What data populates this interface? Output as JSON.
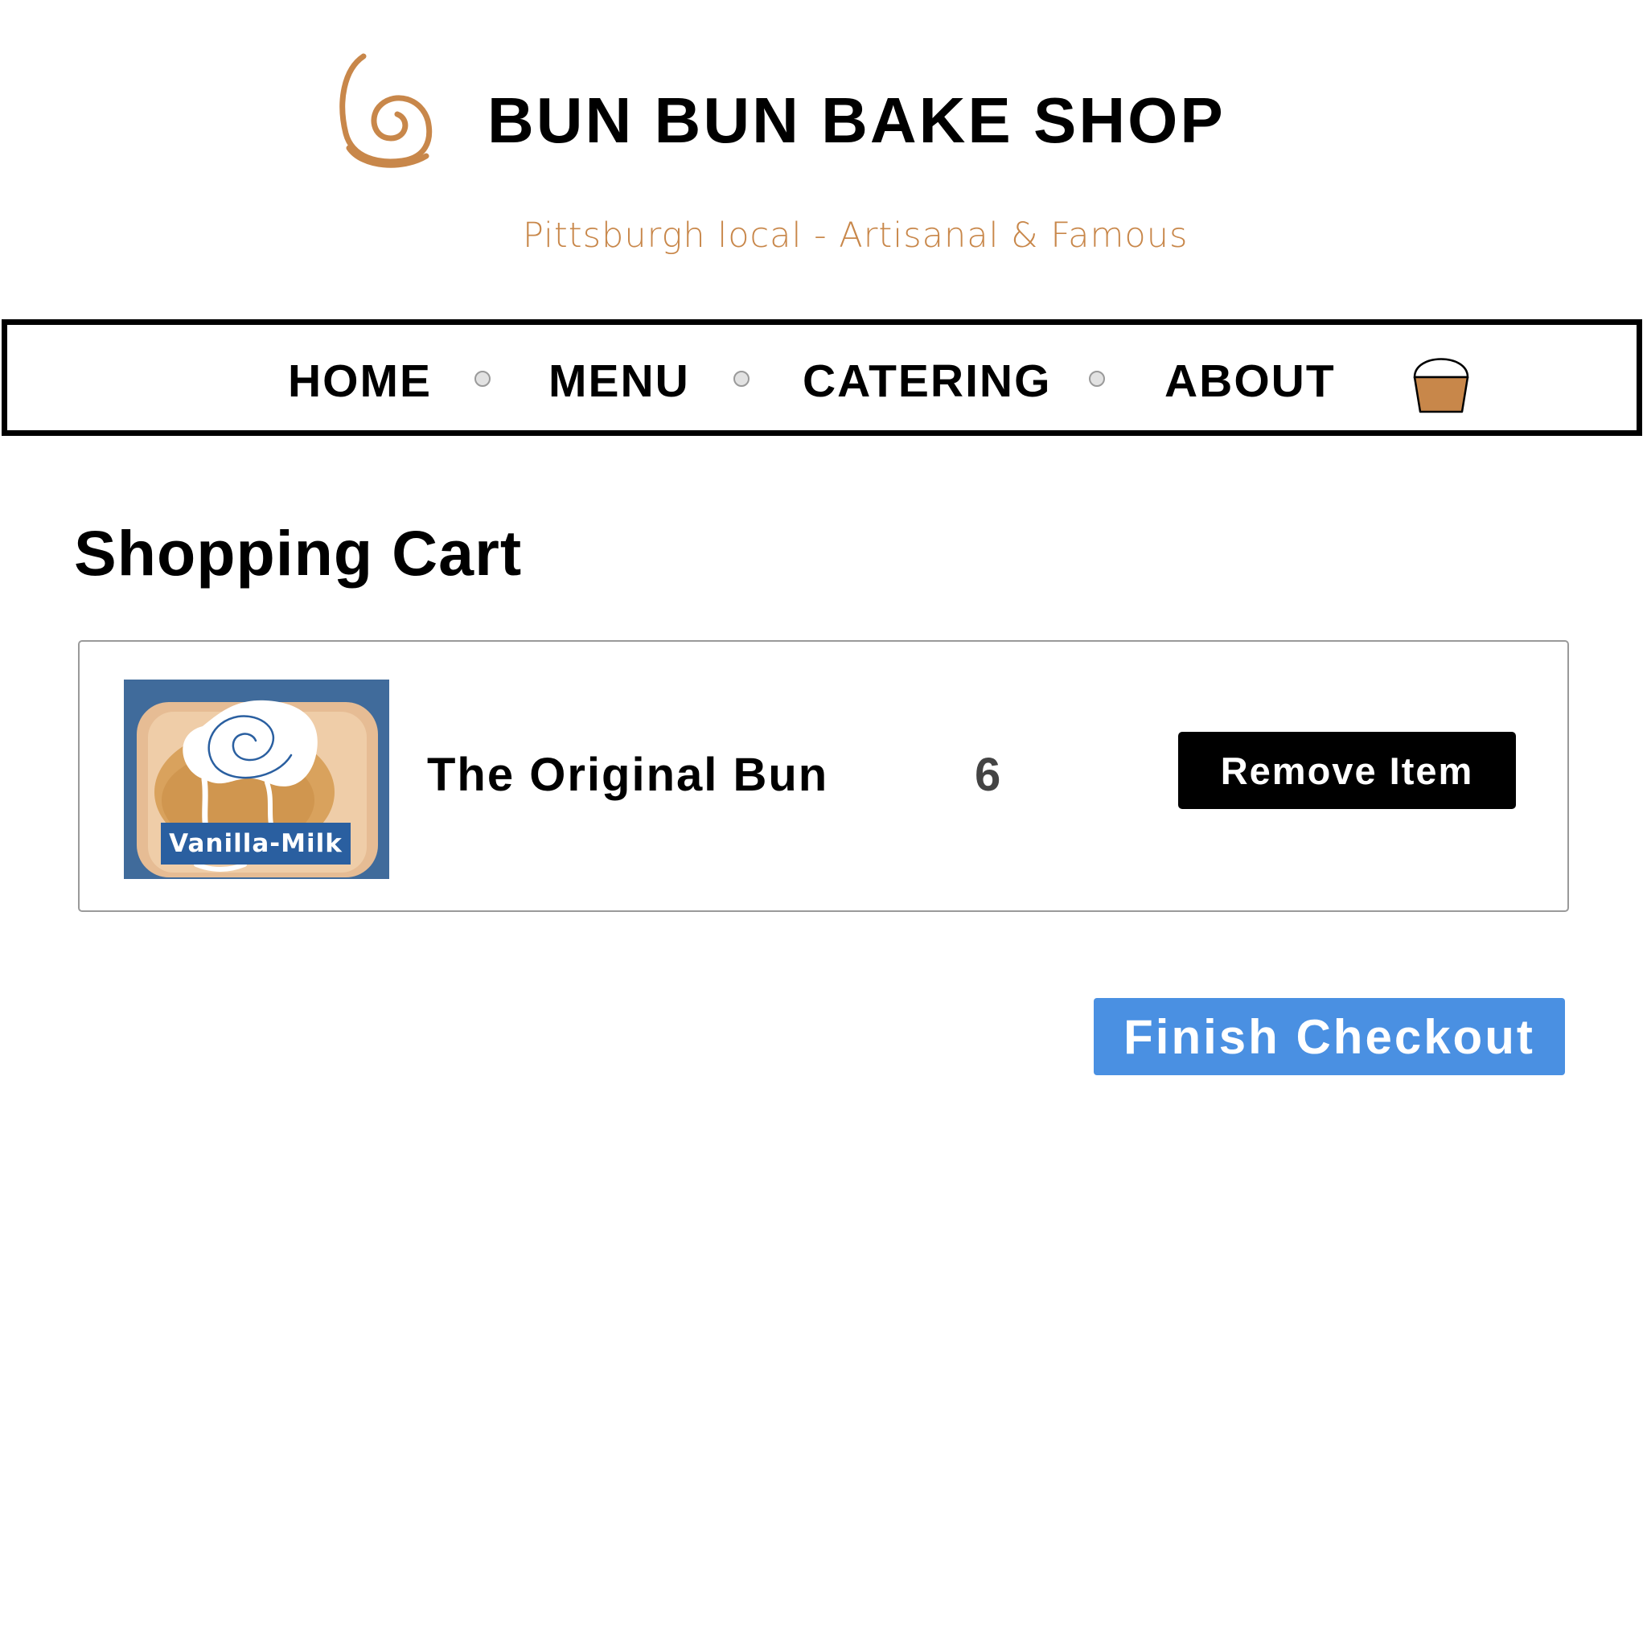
{
  "brand": {
    "name": "BUN BUN BAKE SHOP",
    "tagline": "Pittsburgh local -  Artisanal & Famous",
    "logo_icon": "cinnamon-roll-swirl-icon",
    "accent_color": "#c8874a"
  },
  "nav": {
    "items": [
      {
        "label": "HOME"
      },
      {
        "label": "MENU"
      },
      {
        "label": "CATERING"
      },
      {
        "label": "ABOUT"
      }
    ],
    "cart_icon": "shopping-bag-icon",
    "separator_icon": "dot"
  },
  "main": {
    "title": "Shopping Cart",
    "cart_items": [
      {
        "name": "The Original Bun",
        "quantity": "6",
        "flavor": "Vanilla-Milk",
        "remove_label": "Remove Item"
      }
    ],
    "checkout_label": "Finish Checkout",
    "checkout_color": "#4a90e2"
  }
}
